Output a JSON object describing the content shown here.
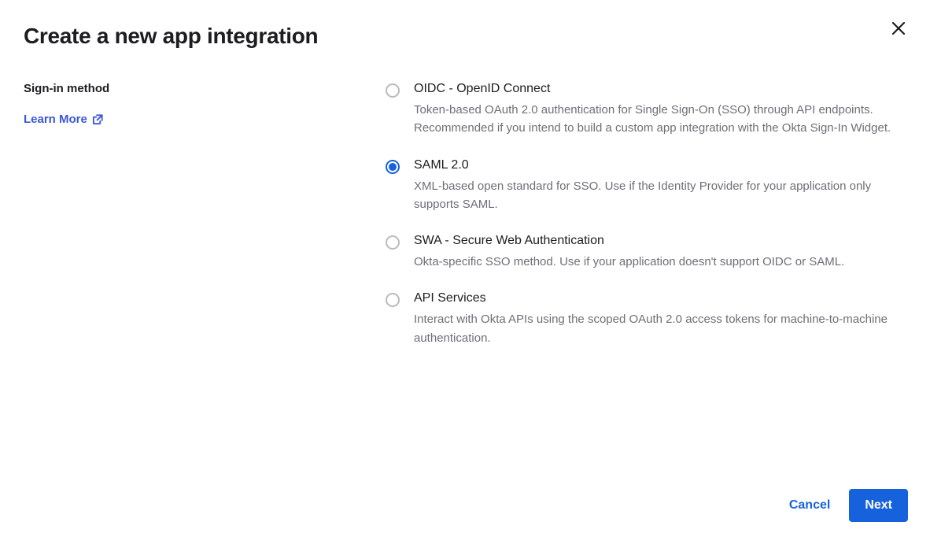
{
  "title": "Create a new app integration",
  "left": {
    "section_label": "Sign-in method",
    "learn_more": "Learn More"
  },
  "options": [
    {
      "title": "OIDC - OpenID Connect",
      "desc": "Token-based OAuth 2.0 authentication for Single Sign-On (SSO) through API endpoints. Recommended if you intend to build a custom app integration with the Okta Sign-In Widget.",
      "selected": false
    },
    {
      "title": "SAML 2.0",
      "desc": "XML-based open standard for SSO. Use if the Identity Provider for your application only supports SAML.",
      "selected": true
    },
    {
      "title": "SWA - Secure Web Authentication",
      "desc": "Okta-specific SSO method. Use if your application doesn't support OIDC or SAML.",
      "selected": false
    },
    {
      "title": "API Services",
      "desc": "Interact with Okta APIs using the scoped OAuth 2.0 access tokens for machine-to-machine authentication.",
      "selected": false
    }
  ],
  "footer": {
    "cancel": "Cancel",
    "next": "Next"
  }
}
